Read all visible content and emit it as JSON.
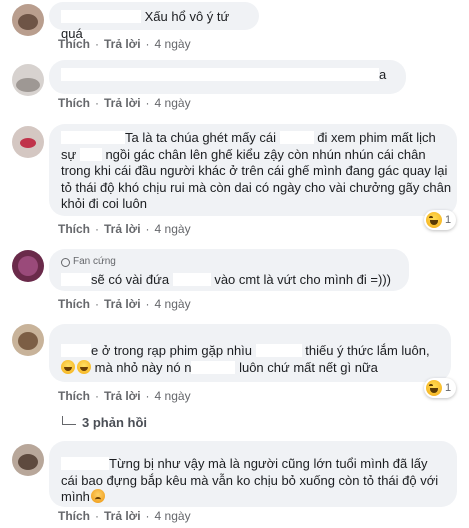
{
  "actions": {
    "like": "Thích",
    "reply": "Trả lời",
    "dot": "·"
  },
  "comments": [
    {
      "text": "Xấu hổ vô ý tứ quá",
      "time": "4 ngày"
    },
    {
      "text": "a",
      "time": "4 ngày"
    },
    {
      "line1_pre": "Ta là ta chúa ghét mấy cái ",
      "line1_post": " đi xem phim mất lịch",
      "line2_pre": "sự ",
      "line2_post": " ngồi gác chân lên ghế kiểu zậy còn nhún nhún cái chân",
      "line3": "trong khi cái đầu người khác ở trên cái ghế mình đang gác quay lại",
      "line4": "tỏ thái độ khó chịu rui mà còn dai có ngày cho vài chưởng gãy chân",
      "line5": "khỏi đi coi luôn",
      "time": "4 ngày",
      "reaction_count": "1"
    },
    {
      "badge": "Fan cứng",
      "line1_pre": "sẽ có vài đứa ",
      "line1_post": " vào cmt là vứt cho mình đi =)))",
      "time": "4 ngày"
    },
    {
      "line1": "e ở trong rạp phim gặp nhìu ",
      "line1_post": " thiếu ý thức lắm luôn,",
      "line2_pre": " mà nhỏ này nó n",
      "line2_post": " luôn chứ mất nết gì nữa",
      "time": "4 ngày",
      "reaction_count": "1",
      "replies": "3 phản hồi"
    },
    {
      "line1": "Từng bị như vậy mà là người cũng lớn tuổi mình đã lấy",
      "line2": "cái bao đựng bắp kêu mà vẫn ko chịu bỏ xuống còn tỏ thái độ với",
      "line3": "mình",
      "time": "4 ngày"
    }
  ]
}
